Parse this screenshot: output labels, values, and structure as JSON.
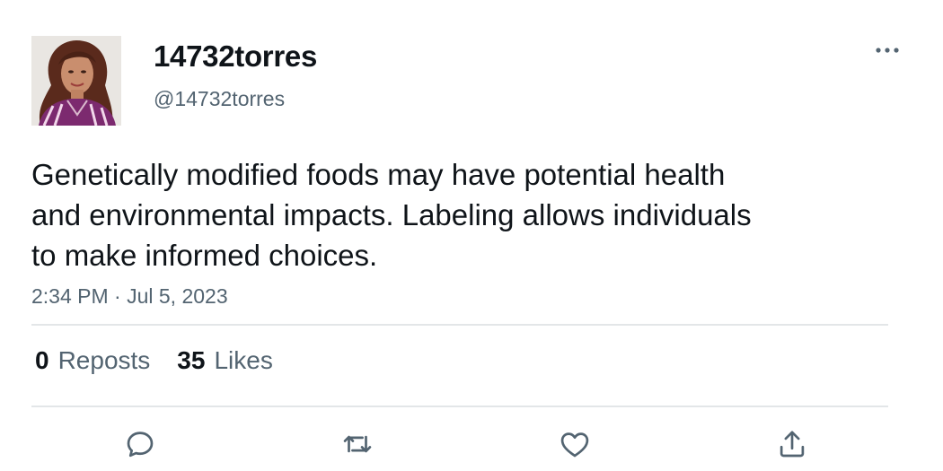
{
  "user": {
    "display_name": "14732torres",
    "handle": "@14732torres",
    "avatar_icon": "profile-photo"
  },
  "tweet": {
    "text_lines": [
      "Genetically modified foods may have potential health",
      "and environmental impacts. Labeling allows individuals",
      "to make informed choices."
    ],
    "timestamp": "2:34 PM · Jul 5, 2023"
  },
  "stats": {
    "reposts_count": "0",
    "reposts_label": "Reposts",
    "likes_count": "35",
    "likes_label": "Likes"
  },
  "actions": {
    "icons": [
      "reply-icon",
      "repost-icon",
      "like-icon",
      "share-icon"
    ]
  },
  "menu": {
    "icon": "more-options-icon"
  },
  "colors": {
    "text_primary": "#0f1419",
    "text_secondary": "#536471",
    "divider": "#e3e6e8"
  }
}
